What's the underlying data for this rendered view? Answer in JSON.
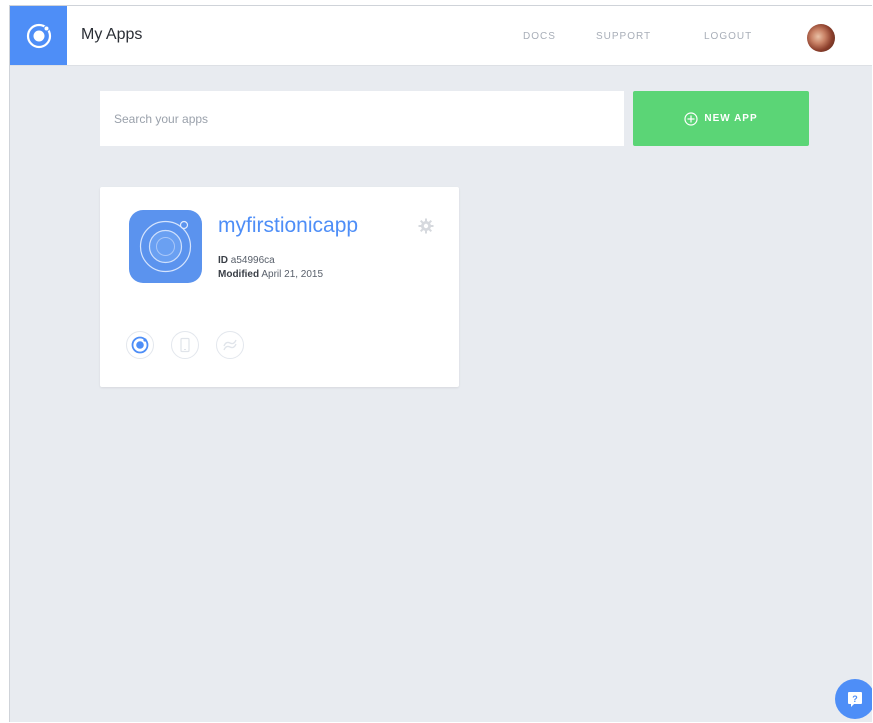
{
  "header": {
    "title": "My Apps",
    "nav": {
      "docs": "DOCS",
      "support": "SUPPORT",
      "logout": "LOGOUT"
    }
  },
  "search": {
    "placeholder": "Search your apps",
    "value": ""
  },
  "new_app_button": {
    "label": "NEW APP",
    "icon": "plus-circle-icon"
  },
  "apps": [
    {
      "name": "myfirstionicapp",
      "id_label": "ID",
      "id_value": "a54996ca",
      "modified_label": "Modified",
      "modified_value": "April 21, 2015",
      "icons": [
        "ionic-logo-icon",
        "device-icon",
        "link-icon"
      ]
    }
  ],
  "colors": {
    "brand_blue": "#4e8ef7",
    "new_app_green": "#5bd576",
    "background": "#e8ebf0"
  }
}
